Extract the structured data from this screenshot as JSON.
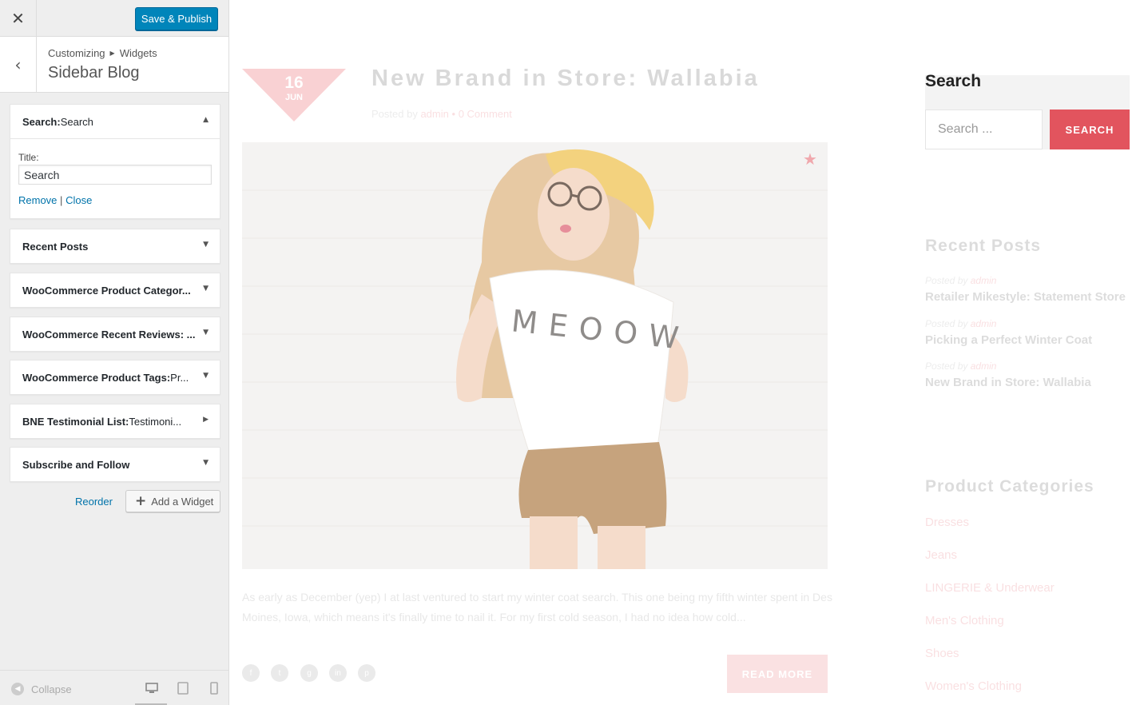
{
  "customizer": {
    "save_label": "Save & Publish",
    "breadcrumb": [
      "Customizing",
      "Widgets"
    ],
    "section_title": "Sidebar Blog",
    "widgets": [
      {
        "type": "Search:",
        "title": " Search"
      },
      {
        "type": "Recent Posts",
        "title": ""
      },
      {
        "type": "WooCommerce Product Categor...",
        "title": ""
      },
      {
        "type": "WooCommerce Recent Reviews: ...",
        "title": ""
      },
      {
        "type": "WooCommerce Product Tags:",
        "title": " Pr..."
      },
      {
        "type": "BNE Testimonial List:",
        "title": " Testimoni..."
      },
      {
        "type": "Subscribe and Follow",
        "title": ""
      }
    ],
    "search_form": {
      "title_label": "Title:",
      "title_value": "Search",
      "remove": "Remove",
      "sep": "|",
      "close": "Close"
    },
    "reorder": "Reorder",
    "add_widget": "Add a Widget",
    "collapse": "Collapse"
  },
  "preview": {
    "date_day": "16",
    "date_month": "JUN",
    "post_title": "New Brand in Store: Wallabia",
    "posted_by": "Posted by",
    "author": "admin",
    "bullet": "•",
    "comments": "0 Comment",
    "excerpt": "As early as December (yep) I at last ventured to start my winter coat search. This one being my fifth winter spent in Des Moines, Iowa, which means it's finally time to nail it. For my first cold season, I had no idea how cold...",
    "read_more": "READ MORE",
    "shirt_text": "MEOOW",
    "sidebar": {
      "search_heading": "Search",
      "search_placeholder": "Search ...",
      "search_button": "SEARCH",
      "recent_heading": "Recent Posts",
      "recent_posts": [
        {
          "meta": "Posted by",
          "author": "admin",
          "title": "Retailer Mikestyle: Statement Store"
        },
        {
          "meta": "Posted by",
          "author": "admin",
          "title": "Picking a Perfect Winter Coat"
        },
        {
          "meta": "Posted by",
          "author": "admin",
          "title": "New Brand in Store: Wallabia"
        }
      ],
      "categories_heading": "Product Categories",
      "categories": [
        "Dresses",
        "Jeans",
        "LINGERIE & Underwear",
        "Men's Clothing",
        "Shoes",
        "Women's Clothing"
      ]
    }
  },
  "colors": {
    "accent": "#e2545e",
    "primary_button": "#0085ba"
  }
}
